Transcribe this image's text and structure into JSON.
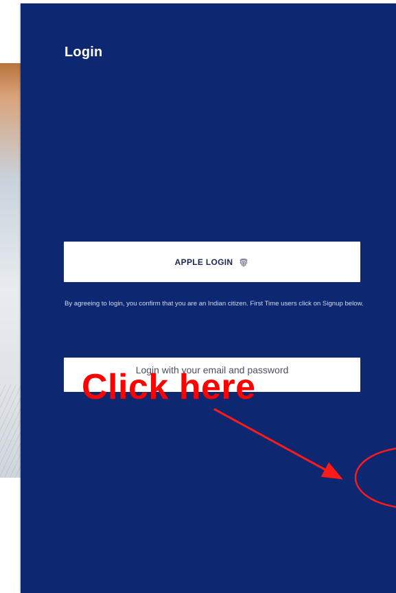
{
  "panel": {
    "title": "Login",
    "background_color": "#0d2870"
  },
  "apple_login": {
    "label": "APPLE LOGIN",
    "icon": "fingerprint-icon"
  },
  "disclaimer": {
    "text": "By agreeing to login, you confirm that you are an Indian citizen. First Time users click on Signup below."
  },
  "email_login": {
    "label": "Login with your email and password"
  },
  "annotation": {
    "text": "Click here",
    "color": "#ff0000",
    "shapes": [
      "arrow",
      "ellipse"
    ]
  }
}
